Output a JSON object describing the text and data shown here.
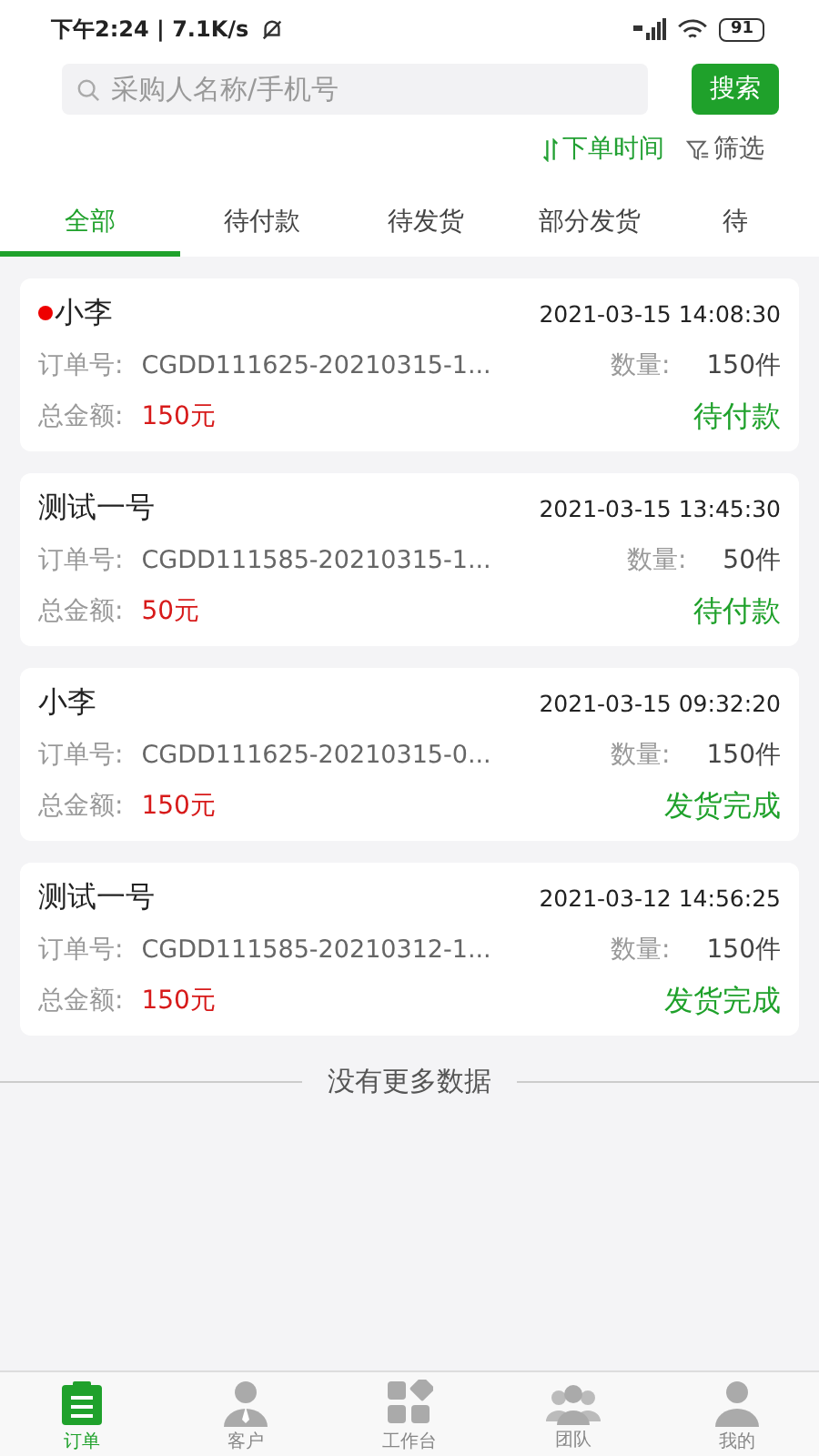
{
  "status_bar": {
    "time": "下午2:24 | 7.1K/s",
    "battery": "91"
  },
  "search": {
    "placeholder": "采购人名称/手机号",
    "button": "搜索"
  },
  "sort": {
    "label": "下单时间"
  },
  "filter": {
    "label": "筛选"
  },
  "tabs": [
    {
      "label": "全部",
      "selected": true
    },
    {
      "label": "待付款",
      "selected": false
    },
    {
      "label": "待发货",
      "selected": false
    },
    {
      "label": "部分发货",
      "selected": false
    },
    {
      "label": "待",
      "selected": false
    }
  ],
  "orders": [
    {
      "unread": true,
      "name": "小李",
      "time": "2021-03-15 14:08:30",
      "order_label": "订单号:",
      "order_no": "CGDD111625-20210315-1...",
      "qty_label": "数量:",
      "qty": "150件",
      "amount_label": "总金额:",
      "amount": "150元",
      "status": "待付款"
    },
    {
      "unread": false,
      "name": "测试一号",
      "time": "2021-03-15 13:45:30",
      "order_label": "订单号:",
      "order_no": "CGDD111585-20210315-1...",
      "qty_label": "数量:",
      "qty": "50件",
      "amount_label": "总金额:",
      "amount": "50元",
      "status": "待付款"
    },
    {
      "unread": false,
      "name": "小李",
      "time": "2021-03-15 09:32:20",
      "order_label": "订单号:",
      "order_no": "CGDD111625-20210315-0...",
      "qty_label": "数量:",
      "qty": "150件",
      "amount_label": "总金额:",
      "amount": "150元",
      "status": "发货完成"
    },
    {
      "unread": false,
      "name": "测试一号",
      "time": "2021-03-12 14:56:25",
      "order_label": "订单号:",
      "order_no": "CGDD111585-20210312-1...",
      "qty_label": "数量:",
      "qty": "150件",
      "amount_label": "总金额:",
      "amount": "150元",
      "status": "发货完成"
    }
  ],
  "end_note": "没有更多数据",
  "nav": [
    {
      "kind": "orders",
      "label": "订单",
      "selected": true
    },
    {
      "kind": "customers",
      "label": "客户",
      "selected": false
    },
    {
      "kind": "workbench",
      "label": "工作台",
      "selected": false
    },
    {
      "kind": "team",
      "label": "团队",
      "selected": false
    },
    {
      "kind": "me",
      "label": "我的",
      "selected": false
    }
  ]
}
